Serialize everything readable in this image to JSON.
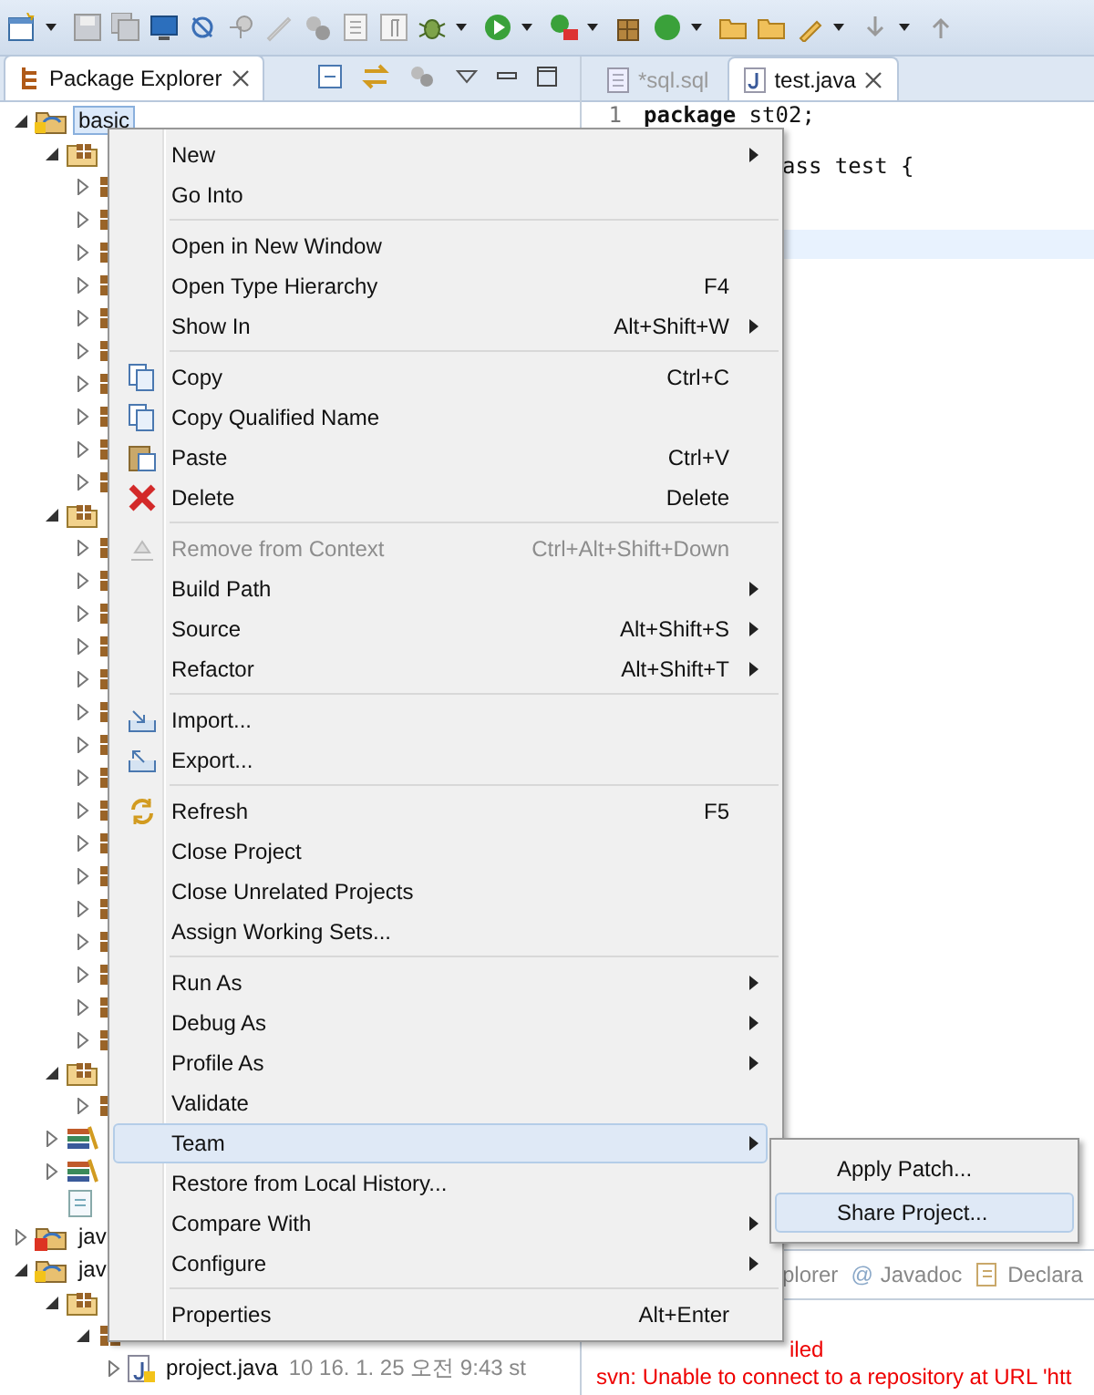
{
  "package_explorer": {
    "title": "Package Explorer",
    "tree": [
      {
        "kind": "project",
        "label": "basic",
        "selected": true,
        "expanded": true,
        "children": [
          {
            "kind": "package-folder",
            "expanded": true,
            "children": [
              {
                "kind": "package",
                "expanded": false
              },
              {
                "kind": "package",
                "expanded": false
              },
              {
                "kind": "package",
                "expanded": false
              },
              {
                "kind": "package",
                "expanded": false
              },
              {
                "kind": "package",
                "expanded": false
              },
              {
                "kind": "package",
                "expanded": false
              },
              {
                "kind": "package",
                "expanded": false
              },
              {
                "kind": "package",
                "expanded": false
              },
              {
                "kind": "package",
                "expanded": false
              },
              {
                "kind": "package",
                "expanded": false
              }
            ]
          },
          {
            "kind": "package-folder",
            "expanded": true,
            "children": [
              {
                "kind": "package",
                "expanded": false
              },
              {
                "kind": "package",
                "expanded": false
              },
              {
                "kind": "package",
                "expanded": false
              },
              {
                "kind": "package",
                "expanded": false
              },
              {
                "kind": "package",
                "expanded": false
              },
              {
                "kind": "package",
                "expanded": false
              },
              {
                "kind": "package",
                "expanded": false
              },
              {
                "kind": "package",
                "expanded": false
              },
              {
                "kind": "package",
                "expanded": false
              },
              {
                "kind": "package",
                "expanded": false
              },
              {
                "kind": "package",
                "expanded": false
              },
              {
                "kind": "package",
                "expanded": false
              },
              {
                "kind": "package",
                "expanded": false
              },
              {
                "kind": "package",
                "expanded": false
              },
              {
                "kind": "package",
                "expanded": false
              },
              {
                "kind": "package",
                "expanded": false
              }
            ]
          },
          {
            "kind": "package-folder",
            "expanded": true,
            "children": [
              {
                "kind": "package",
                "expanded": false
              }
            ]
          },
          {
            "kind": "library",
            "expanded": false
          },
          {
            "kind": "library",
            "expanded": false
          },
          {
            "kind": "file"
          }
        ]
      },
      {
        "kind": "project-error",
        "label": "jav",
        "selected": false,
        "expanded": false
      },
      {
        "kind": "project",
        "label": "jav",
        "selected": false,
        "expanded": true,
        "children": [
          {
            "kind": "package-folder",
            "expanded": true,
            "children": [
              {
                "kind": "package",
                "expanded": true,
                "children": [
                  {
                    "kind": "java-file",
                    "label": "project.java",
                    "detail": "10  16. 1. 25 오전 9:43  st",
                    "expanded": false
                  }
                ]
              }
            ]
          }
        ]
      }
    ]
  },
  "editor": {
    "tabs": [
      {
        "label": "*sql.sql",
        "selected": false
      },
      {
        "label": "test.java",
        "selected": true
      }
    ],
    "lines": [
      {
        "kind": "code",
        "number": "1",
        "text": "**package** st02;"
      },
      {
        "kind": "blank"
      },
      {
        "kind": "partial",
        "text": "ass test {"
      },
      {
        "kind": "blank"
      },
      {
        "kind": "blank"
      },
      {
        "kind": "current"
      }
    ]
  },
  "bottom_panel": {
    "tabs": [
      {
        "label": "plorer"
      },
      {
        "glyph": "@",
        "label": "Javadoc"
      },
      {
        "label": "Declara"
      }
    ],
    "console": [
      "iled",
      "svn: Unable to connect to a repository at URL 'htt"
    ]
  },
  "context_menu": [
    {
      "kind": "item",
      "label": "New",
      "submenu": true,
      "disabled": false,
      "selected": false
    },
    {
      "kind": "item",
      "label": "Go Into",
      "submenu": false,
      "disabled": false,
      "selected": false
    },
    {
      "kind": "separator"
    },
    {
      "kind": "item",
      "label": "Open in New Window",
      "submenu": false,
      "disabled": false,
      "selected": false
    },
    {
      "kind": "item",
      "label": "Open Type Hierarchy",
      "shortcut": "F4",
      "submenu": false,
      "disabled": false,
      "selected": false
    },
    {
      "kind": "item",
      "label": "Show In",
      "shortcut": "Alt+Shift+W",
      "submenu": true,
      "disabled": false,
      "selected": false
    },
    {
      "kind": "separator"
    },
    {
      "kind": "item",
      "label": "Copy",
      "shortcut": "Ctrl+C",
      "submenu": false,
      "disabled": false,
      "selected": false
    },
    {
      "kind": "item",
      "label": "Copy Qualified Name",
      "submenu": false,
      "disabled": false,
      "selected": false
    },
    {
      "kind": "item",
      "label": "Paste",
      "shortcut": "Ctrl+V",
      "submenu": false,
      "disabled": false,
      "selected": false
    },
    {
      "kind": "item",
      "label": "Delete",
      "shortcut": "Delete",
      "submenu": false,
      "disabled": false,
      "selected": false
    },
    {
      "kind": "separator"
    },
    {
      "kind": "item",
      "label": "Remove from Context",
      "shortcut": "Ctrl+Alt+Shift+Down",
      "submenu": false,
      "disabled": true,
      "selected": false
    },
    {
      "kind": "item",
      "label": "Build Path",
      "submenu": true,
      "disabled": false,
      "selected": false
    },
    {
      "kind": "item",
      "label": "Source",
      "shortcut": "Alt+Shift+S",
      "submenu": true,
      "disabled": false,
      "selected": false
    },
    {
      "kind": "item",
      "label": "Refactor",
      "shortcut": "Alt+Shift+T",
      "submenu": true,
      "disabled": false,
      "selected": false
    },
    {
      "kind": "separator"
    },
    {
      "kind": "item",
      "label": "Import...",
      "submenu": false,
      "disabled": false,
      "selected": false
    },
    {
      "kind": "item",
      "label": "Export...",
      "submenu": false,
      "disabled": false,
      "selected": false
    },
    {
      "kind": "separator"
    },
    {
      "kind": "item",
      "label": "Refresh",
      "shortcut": "F5",
      "submenu": false,
      "disabled": false,
      "selected": false
    },
    {
      "kind": "item",
      "label": "Close Project",
      "submenu": false,
      "disabled": false,
      "selected": false
    },
    {
      "kind": "item",
      "label": "Close Unrelated Projects",
      "submenu": false,
      "disabled": false,
      "selected": false
    },
    {
      "kind": "item",
      "label": "Assign Working Sets...",
      "submenu": false,
      "disabled": false,
      "selected": false
    },
    {
      "kind": "separator"
    },
    {
      "kind": "item",
      "label": "Run As",
      "submenu": true,
      "disabled": false,
      "selected": false
    },
    {
      "kind": "item",
      "label": "Debug As",
      "submenu": true,
      "disabled": false,
      "selected": false
    },
    {
      "kind": "item",
      "label": "Profile As",
      "submenu": true,
      "disabled": false,
      "selected": false
    },
    {
      "kind": "item",
      "label": "Validate",
      "submenu": false,
      "disabled": false,
      "selected": false
    },
    {
      "kind": "item",
      "label": "Team",
      "submenu": true,
      "disabled": false,
      "selected": true
    },
    {
      "kind": "item",
      "label": "Restore from Local History...",
      "submenu": false,
      "disabled": false,
      "selected": false
    },
    {
      "kind": "item",
      "label": "Compare With",
      "submenu": true,
      "disabled": false,
      "selected": false
    },
    {
      "kind": "item",
      "label": "Configure",
      "submenu": true,
      "disabled": false,
      "selected": false
    },
    {
      "kind": "separator"
    },
    {
      "kind": "item",
      "label": "Properties",
      "shortcut": "Alt+Enter",
      "submenu": false,
      "disabled": false,
      "selected": false
    }
  ],
  "team_submenu": [
    {
      "label": "Apply Patch...",
      "selected": false
    },
    {
      "label": "Share Project...",
      "selected": true
    }
  ]
}
